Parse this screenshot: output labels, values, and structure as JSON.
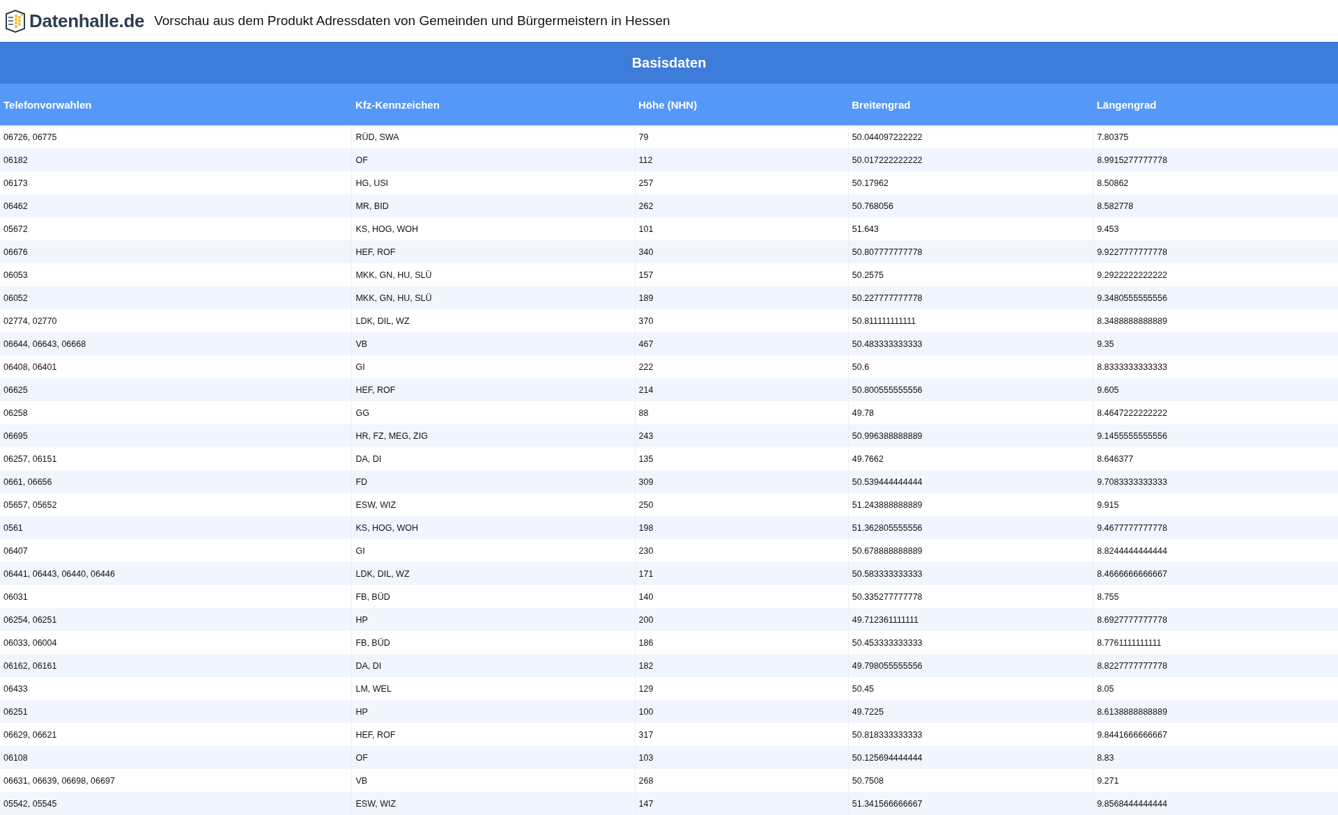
{
  "header": {
    "logo_text": "Datenhalle.de",
    "title": "Vorschau aus dem Produkt Adressdaten von Gemeinden und Bürgermeistern in Hessen"
  },
  "table": {
    "caption": "Basisdaten",
    "columns": [
      "Telefonvorwahlen",
      "Kfz-Kennzeichen",
      "Höhe (NHN)",
      "Breitengrad",
      "Längengrad"
    ],
    "rows": [
      [
        "06726, 06775",
        "RÜD, SWA",
        "79",
        "50.044097222222",
        "7.80375"
      ],
      [
        "06182",
        "OF",
        "112",
        "50.017222222222",
        "8.9915277777778"
      ],
      [
        "06173",
        "HG, USI",
        "257",
        "50.17962",
        "8.50862"
      ],
      [
        "06462",
        "MR, BID",
        "262",
        "50.768056",
        "8.582778"
      ],
      [
        "05672",
        "KS, HOG, WOH",
        "101",
        "51.643",
        "9.453"
      ],
      [
        "06676",
        "HEF, ROF",
        "340",
        "50.807777777778",
        "9.9227777777778"
      ],
      [
        "06053",
        "MKK, GN, HU, SLÜ",
        "157",
        "50.2575",
        "9.2922222222222"
      ],
      [
        "06052",
        "MKK, GN, HU, SLÜ",
        "189",
        "50.227777777778",
        "9.3480555555556"
      ],
      [
        "02774, 02770",
        "LDK, DIL, WZ",
        "370",
        "50.811111111111",
        "8.3488888888889"
      ],
      [
        "06644, 06643, 06668",
        "VB",
        "467",
        "50.483333333333",
        "9.35"
      ],
      [
        "06408, 06401",
        "GI",
        "222",
        "50.6",
        "8.8333333333333"
      ],
      [
        "06625",
        "HEF, ROF",
        "214",
        "50.800555555556",
        "9.605"
      ],
      [
        "06258",
        "GG",
        "88",
        "49.78",
        "8.4647222222222"
      ],
      [
        "06695",
        "HR, FZ, MEG, ZIG",
        "243",
        "50.996388888889",
        "9.1455555555556"
      ],
      [
        "06257, 06151",
        "DA, DI",
        "135",
        "49.7662",
        "8.646377"
      ],
      [
        "0661, 06656",
        "FD",
        "309",
        "50.539444444444",
        "9.7083333333333"
      ],
      [
        "05657, 05652",
        "ESW, WIZ",
        "250",
        "51.243888888889",
        "9.915"
      ],
      [
        "0561",
        "KS, HOG, WOH",
        "198",
        "51.362805555556",
        "9.4677777777778"
      ],
      [
        "06407",
        "GI",
        "230",
        "50.678888888889",
        "8.8244444444444"
      ],
      [
        "06441, 06443, 06440, 06446",
        "LDK, DIL, WZ",
        "171",
        "50.583333333333",
        "8.4666666666667"
      ],
      [
        "06031",
        "FB, BÜD",
        "140",
        "50.335277777778",
        "8.755"
      ],
      [
        "06254, 06251",
        "HP",
        "200",
        "49.712361111111",
        "8.6927777777778"
      ],
      [
        "06033, 06004",
        "FB, BÜD",
        "186",
        "50.453333333333",
        "8.7761111111111"
      ],
      [
        "06162, 06161",
        "DA, DI",
        "182",
        "49.798055555556",
        "8.8227777777778"
      ],
      [
        "06433",
        "LM, WEL",
        "129",
        "50.45",
        "8.05"
      ],
      [
        "06251",
        "HP",
        "100",
        "49.7225",
        "8.6138888888889"
      ],
      [
        "06629, 06621",
        "HEF, ROF",
        "317",
        "50.818333333333",
        "9.8441666666667"
      ],
      [
        "06108",
        "OF",
        "103",
        "50.125694444444",
        "8.83"
      ],
      [
        "06631, 06639, 06698, 06697",
        "VB",
        "268",
        "50.7508",
        "9.271"
      ],
      [
        "05542, 05545",
        "ESW, WIZ",
        "147",
        "51.341566666667",
        "9.8568444444444"
      ]
    ]
  }
}
